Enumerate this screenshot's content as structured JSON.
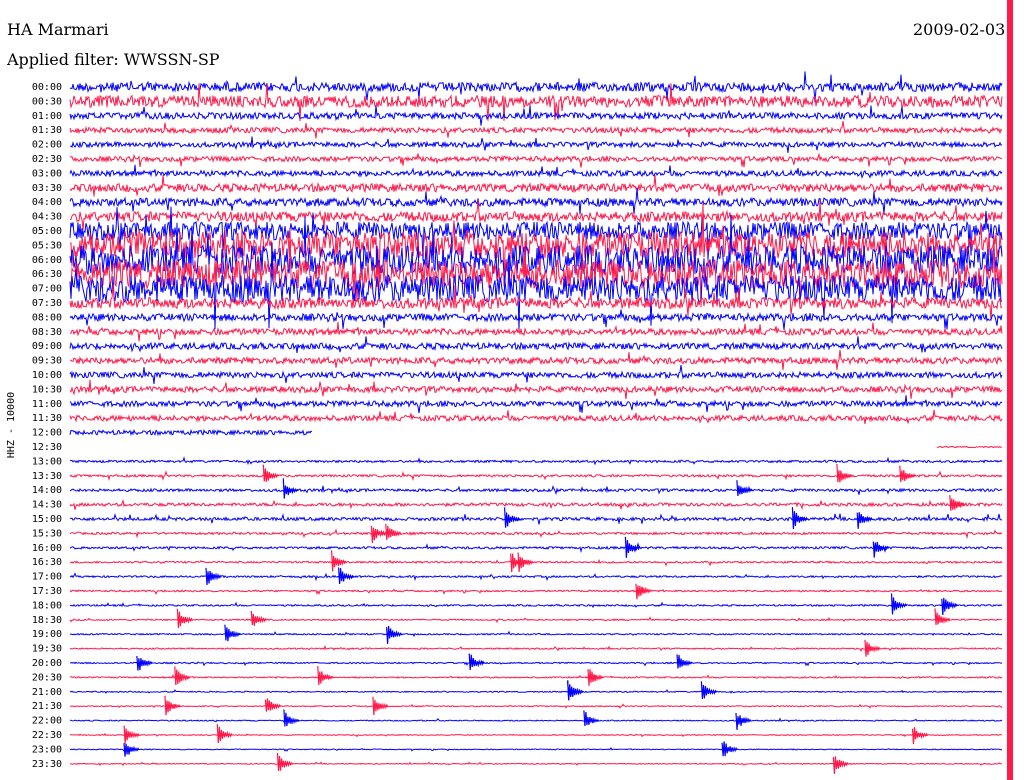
{
  "header": {
    "station": "HA Marmari",
    "date": "2009-02-03",
    "filter": "Applied filter: WWSSN-SP"
  },
  "chart_data": {
    "type": "line",
    "title": "HA Marmari",
    "ylabel": "HHZ - 10000",
    "row_labels": [
      "00:00",
      "00:30",
      "01:00",
      "01:30",
      "02:00",
      "02:30",
      "03:00",
      "03:30",
      "04:00",
      "04:30",
      "05:00",
      "05:30",
      "06:00",
      "06:30",
      "07:00",
      "07:30",
      "08:00",
      "08:30",
      "09:00",
      "09:30",
      "10:00",
      "10:30",
      "11:00",
      "11:30",
      "12:00",
      "12:30",
      "13:00",
      "13:30",
      "14:00",
      "14:30",
      "15:00",
      "15:30",
      "16:00",
      "16:30",
      "17:00",
      "17:30",
      "18:00",
      "18:30",
      "19:00",
      "19:30",
      "20:00",
      "20:30",
      "21:00",
      "21:30",
      "22:00",
      "22:30",
      "23:00",
      "23:30"
    ],
    "trace_colors": [
      "#0000ff",
      "#ff1a4a"
    ],
    "current_time_marker_color": "#ff1a4a",
    "relative_amplitude": [
      1.0,
      1.3,
      0.7,
      0.6,
      0.55,
      0.55,
      0.6,
      0.9,
      0.9,
      1.1,
      2.0,
      3.0,
      3.2,
      3.2,
      3.0,
      1.2,
      0.8,
      0.7,
      0.7,
      0.7,
      0.65,
      0.65,
      0.6,
      0.6,
      0.5,
      0.0,
      0.25,
      0.25,
      0.3,
      0.35,
      0.35,
      0.25,
      0.25,
      0.2,
      0.2,
      0.18,
      0.18,
      0.15,
      0.15,
      0.15,
      0.15,
      0.15,
      0.12,
      0.12,
      0.12,
      0.1,
      0.1,
      0.1
    ],
    "gap": {
      "row": "12:00",
      "ends_at_fraction": 0.26,
      "next_row_starts_at_fraction": 0.93
    }
  }
}
